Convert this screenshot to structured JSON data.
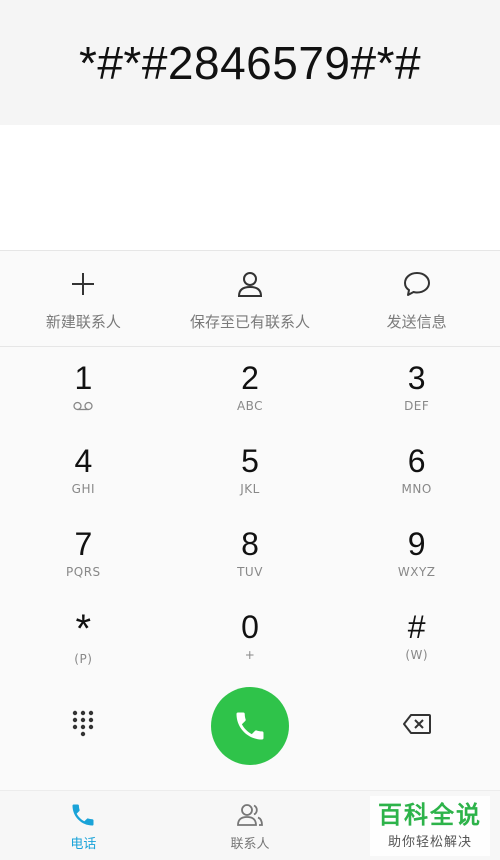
{
  "dialer": {
    "number": "*#*#2846579#*#"
  },
  "actions": [
    {
      "label": "新建联系人",
      "icon": "plus-icon"
    },
    {
      "label": "保存至已有联系人",
      "icon": "person-icon"
    },
    {
      "label": "发送信息",
      "icon": "message-icon"
    }
  ],
  "keypad": {
    "k1": {
      "digit": "1",
      "icon": "voicemail-icon"
    },
    "k2": {
      "digit": "2",
      "sub": "ABC"
    },
    "k3": {
      "digit": "3",
      "sub": "DEF"
    },
    "k4": {
      "digit": "4",
      "sub": "GHI"
    },
    "k5": {
      "digit": "5",
      "sub": "JKL"
    },
    "k6": {
      "digit": "6",
      "sub": "MNO"
    },
    "k7": {
      "digit": "7",
      "sub": "PQRS"
    },
    "k8": {
      "digit": "8",
      "sub": "TUV"
    },
    "k9": {
      "digit": "9",
      "sub": "WXYZ"
    },
    "kstar": {
      "digit": "*",
      "sub": "(P)"
    },
    "k0": {
      "digit": "0",
      "sub": "+"
    },
    "khash": {
      "digit": "#",
      "sub": "(W)"
    }
  },
  "controls": {
    "dialpad_icon": "dialpad-icon",
    "call_icon": "phone-icon",
    "delete_icon": "backspace-icon"
  },
  "tabs": [
    {
      "label": "电话",
      "icon": "phone-icon",
      "active": true
    },
    {
      "label": "联系人",
      "icon": "contacts-icon",
      "active": false
    }
  ],
  "watermark": {
    "title": "百科全说",
    "subtitle": "助你轻松解决"
  },
  "colors": {
    "call_green": "#2fc34a",
    "active_tab": "#1aa3d8",
    "watermark_green": "#2db34a"
  }
}
